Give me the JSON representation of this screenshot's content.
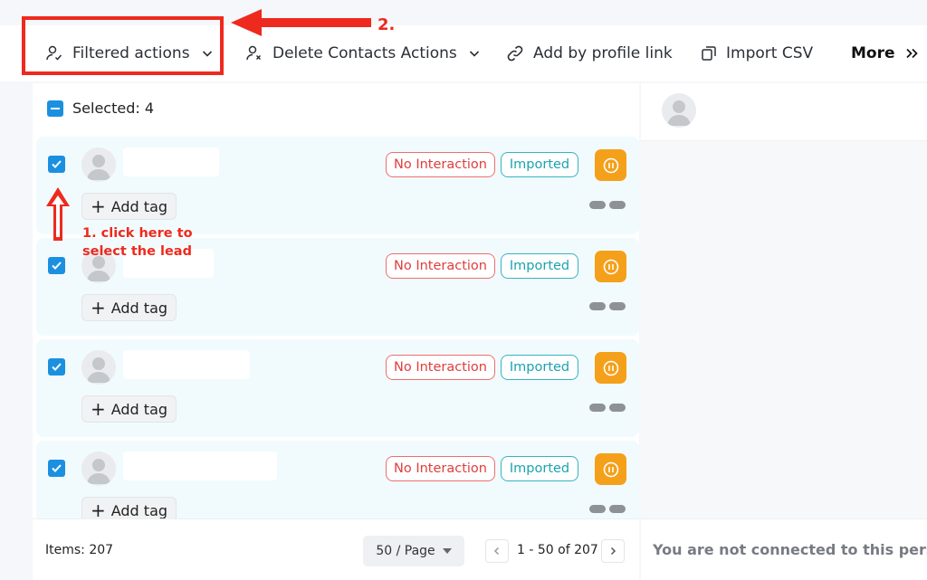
{
  "toolbar": {
    "filtered_actions": "Filtered actions",
    "delete_contacts_actions": "Delete Contacts Actions",
    "add_by_profile_link": "Add by profile link",
    "import_csv": "Import CSV",
    "more": "More"
  },
  "selection": {
    "label": "Selected: 4"
  },
  "leads": [
    {
      "checked": true,
      "status": "No Interaction",
      "source": "Imported",
      "add_tag": "Add tag"
    },
    {
      "checked": true,
      "status": "No Interaction",
      "source": "Imported",
      "add_tag": "Add tag"
    },
    {
      "checked": true,
      "status": "No Interaction",
      "source": "Imported",
      "add_tag": "Add tag"
    },
    {
      "checked": true,
      "status": "No Interaction",
      "source": "Imported",
      "add_tag": "Add tag"
    }
  ],
  "annotations": {
    "step1": "1. click here to select the lead",
    "step2": "2."
  },
  "footer": {
    "items": "Items: 207",
    "page_size": "50 / Page",
    "range": "1 - 50 of 207"
  },
  "detail": {
    "not_connected": "You are not connected to this person"
  },
  "colors": {
    "accent_blue": "#1b90e0",
    "annotation_red": "#ee2a1e",
    "pause_orange": "#f5a01a",
    "no_interaction_red": "#e03d3d",
    "imported_teal": "#1aa3b0"
  }
}
